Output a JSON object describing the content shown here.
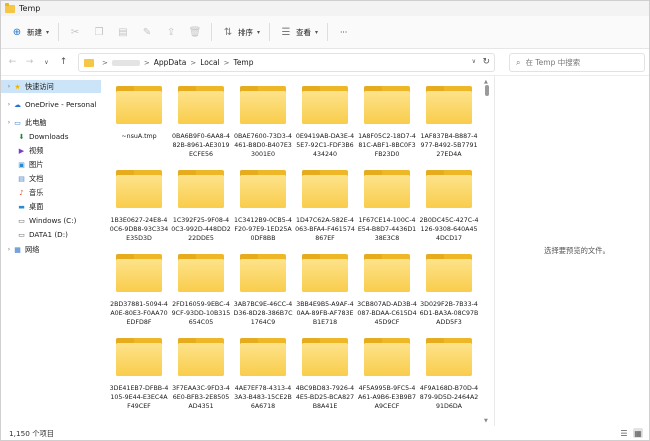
{
  "window": {
    "title": "Temp"
  },
  "toolbar": {
    "new_label": "新建",
    "sort_label": "排序",
    "view_label": "查看",
    "more_label": "···"
  },
  "address": {
    "crumbs": [
      "AppData",
      "Local",
      "Temp"
    ],
    "separator": ">"
  },
  "search": {
    "placeholder": "在 Temp 中搜索"
  },
  "sidebar": {
    "items": [
      {
        "label": "快速访问",
        "icon": "star-icon",
        "glyph": "★",
        "color": "#f0b400"
      },
      {
        "label": "OneDrive - Personal",
        "icon": "cloud-icon",
        "glyph": "☁",
        "color": "#1f75d1"
      },
      {
        "label": "此电脑",
        "icon": "computer-icon",
        "glyph": "▭",
        "color": "#2a6fc9"
      },
      {
        "label": "Downloads",
        "icon": "download-icon",
        "glyph": "⬇",
        "color": "#1a8a3a"
      },
      {
        "label": "视频",
        "icon": "video-icon",
        "glyph": "▶",
        "color": "#7b3fc4"
      },
      {
        "label": "图片",
        "icon": "picture-icon",
        "glyph": "▣",
        "color": "#2a8ad4"
      },
      {
        "label": "文档",
        "icon": "document-icon",
        "glyph": "▤",
        "color": "#4a7fc9"
      },
      {
        "label": "音乐",
        "icon": "music-icon",
        "glyph": "♪",
        "color": "#e0572a"
      },
      {
        "label": "桌面",
        "icon": "desktop-icon",
        "glyph": "▬",
        "color": "#2a8ad4"
      },
      {
        "label": "Windows (C:)",
        "icon": "drive-icon",
        "glyph": "▭",
        "color": "#555555"
      },
      {
        "label": "DATA1 (D:)",
        "icon": "drive-icon",
        "glyph": "▭",
        "color": "#555555"
      },
      {
        "label": "网络",
        "icon": "network-icon",
        "glyph": "▦",
        "color": "#2a6fc9"
      }
    ]
  },
  "files": [
    "~nsuA.tmp",
    "0BA6B9F0-6AA8-482B-8961-AE3019ECFE56",
    "0BAE7600-73D3-4461-B8D0-B407E33001E0",
    "0E9419AB-DA3E-45E7-92C1-FDF3B6434240",
    "1A8F05C2-18D7-481C-ABF1-8BC0F3FB23D0",
    "1AF837B4-B887-4977-B492-5B779127ED4A",
    "1B3E0627-24E8-40C6-9DB8-93C334E35D3D",
    "1C392F25-9F08-40C3-992D-448DD222DDE5",
    "1C3412B9-0CB5-4F20-97E9-1ED25A0DF8BB",
    "1D47C62A-582E-4063-BFA4-F461574867EF",
    "1F67CE14-100C-4E54-B8D7-4436D138E3C8",
    "2B0DC45C-427C-4126-9308-640A454DCD17",
    "2BD37881-5094-4A0E-80E3-F0AA70EDFD8F",
    "2FD16059-9EBC-49CF-93DD-10B315654C05",
    "3AB7BC9E-46CC-4D36-8D28-386B7C1764C9",
    "3BB4E9B5-A9AF-40AA-89FB-AF783EB1E718",
    "3CB807AD-AD3B-4087-BDAA-C615D445D9CF",
    "3D029F2B-7B33-46D1-BA3A-08C97BADD5F3",
    "3DE41EB7-DFBB-4105-9E44-E3EC4AF49CEF",
    "3F7EAA3C-9FD3-46E0-BFB3-2E8505AD4351",
    "4AE7EF78-4313-43A3-B483-15CE2B6A6718",
    "4BC9BD83-7926-44E5-BD25-BCA827B8A41E",
    "4F5A995B-9FC5-4A61-A9B6-E3B9B7A9CECF",
    "4F9A168D-B70D-4879-9D5D-2464A291D6DA"
  ],
  "preview": {
    "text": "选择要预览的文件。"
  },
  "status": {
    "count_text": "1,150 个项目"
  }
}
